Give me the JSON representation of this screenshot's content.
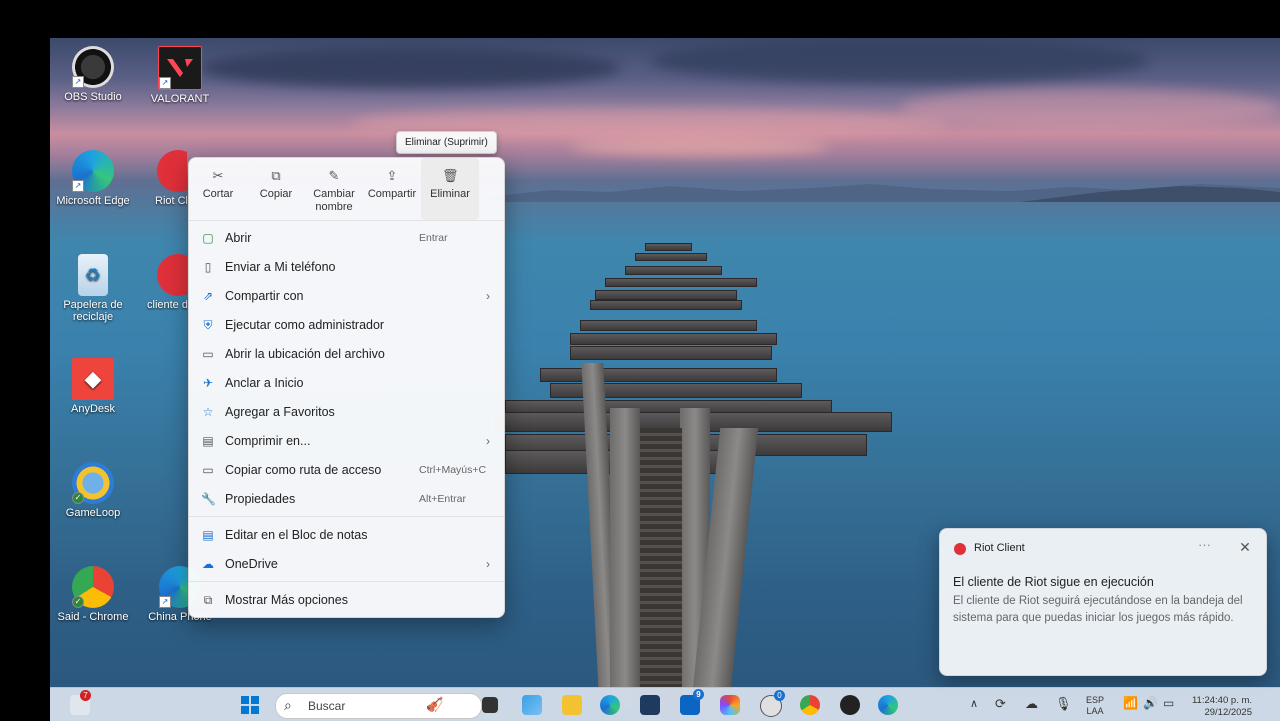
{
  "desktop": {
    "icons": [
      {
        "label": "OBS Studio"
      },
      {
        "label": "VALORANT"
      },
      {
        "label": "Microsoft Edge"
      },
      {
        "label": "Riot Cl"
      },
      {
        "label": "Papelera de reciclaje"
      },
      {
        "label": "cliente d"
      },
      {
        "label": "AnyDesk"
      },
      {
        "label": "GameLoop"
      },
      {
        "label": "Said - Chrome"
      },
      {
        "label": "China Phone"
      }
    ]
  },
  "tooltip": {
    "text": "Eliminar (Suprimir)"
  },
  "context_menu": {
    "quick_actions": [
      {
        "label": "Cortar",
        "icon": "scissors-icon"
      },
      {
        "label": "Copiar",
        "icon": "copy-icon"
      },
      {
        "label": "Cambiar nombre",
        "icon": "rename-icon"
      },
      {
        "label": "Compartir",
        "icon": "share-icon"
      },
      {
        "label": "Eliminar",
        "icon": "trash-icon"
      }
    ],
    "items": [
      {
        "label": "Abrir",
        "shortcut": "Entrar",
        "icon": "open-icon"
      },
      {
        "label": "Enviar a Mi teléfono",
        "shortcut": "",
        "icon": "phone-icon"
      },
      {
        "label": "Compartir con",
        "shortcut": "",
        "icon": "share-with-icon",
        "submenu": true
      },
      {
        "label": "Ejecutar como administrador",
        "shortcut": "",
        "icon": "shield-icon"
      },
      {
        "label": "Abrir la ubicación del archivo",
        "shortcut": "",
        "icon": "folder-icon"
      },
      {
        "label": "Anclar a Inicio",
        "shortcut": "",
        "icon": "pin-icon"
      },
      {
        "label": "Agregar a Favoritos",
        "shortcut": "",
        "icon": "star-icon"
      },
      {
        "label": "Comprimir en...",
        "shortcut": "",
        "icon": "zip-icon",
        "submenu": true
      },
      {
        "label": "Copiar como ruta de acceso",
        "shortcut": "Ctrl+Mayús+C",
        "icon": "path-icon"
      },
      {
        "label": "Propiedades",
        "shortcut": "Alt+Entrar",
        "icon": "wrench-icon"
      },
      {
        "label": "Editar en el Bloc de notas",
        "shortcut": "",
        "icon": "notepad-icon"
      },
      {
        "label": "OneDrive",
        "shortcut": "",
        "icon": "onedrive-icon",
        "submenu": true
      },
      {
        "label": "Mostrar Más opciones",
        "shortcut": "",
        "icon": "more-options-icon"
      }
    ]
  },
  "notification": {
    "app": "Riot Client",
    "more": "···",
    "close": "✕",
    "title": "El cliente de Riot sigue en ejecución",
    "body": "El cliente de Riot seguirá ejecutándose en la bandeja del sistema para que puedas iniciar los juegos más rápido."
  },
  "taskbar": {
    "weather_badge": "7",
    "search_placeholder": "Buscar",
    "lang_top": "ESP",
    "lang_bottom": "LAA",
    "time": "11:24:40 p. m.",
    "date": "29/12/2025",
    "badge_9": "9",
    "badge_0": "0",
    "chevron": "∧"
  },
  "colors": {
    "accent": "#0067c0",
    "riot_red": "#e0303a",
    "valorant_red": "#ff4655"
  }
}
